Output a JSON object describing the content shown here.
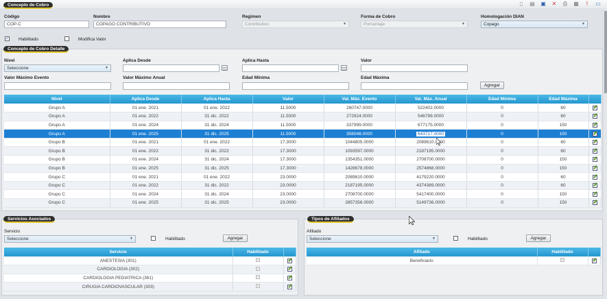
{
  "toolbar": {
    "icons": [
      "page-icon",
      "document-icon",
      "save-icon",
      "delete-icon",
      "print-icon",
      "export-icon",
      "alert-icon",
      "help-icon"
    ]
  },
  "concepto": {
    "title": "Concepto de Cobro",
    "codigo_label": "Código",
    "codigo_value": "COP-C",
    "nombre_label": "Nombre",
    "nombre_value": "COPAGO CONTRIBUTIVO",
    "regimen_label": "Regimen",
    "regimen_value": "Contributivo",
    "forma_label": "Forma de Cobro",
    "forma_value": "Porcentaje",
    "homologacion_label": "Homologación DIAN",
    "homologacion_value": "Copago",
    "habilitado_label": "Habilitado",
    "modifica_label": "Modifica Valor"
  },
  "detalle": {
    "title": "Concepto de Cobro Detalle",
    "nivel_label": "Nivel",
    "nivel_value": "Seleccione",
    "aplica_desde_label": "Aplica Desde",
    "aplica_hasta_label": "Aplica Hasta",
    "valor_label": "Valor",
    "valor_max_evento_label": "Valor Máximo Evento",
    "valor_max_anual_label": "Valor Máximo Anual",
    "edad_min_label": "Edad Mínima",
    "edad_max_label": "Edad Máxima",
    "agregar_label": "Agregar"
  },
  "grid": {
    "headers": [
      "Nivel",
      "Aplica Desde",
      "Aplica Hasta",
      "Valor",
      "Val. Máx. Evento",
      "Val. Máx. Anual",
      "Edad Mínima",
      "Edad Máxima"
    ],
    "rows": [
      [
        "Grupo A",
        "01 ene. 2021",
        "01 ene. 2022",
        "11.5000",
        "260747.0000",
        "522402.0000",
        "0",
        "60"
      ],
      [
        "Grupo A",
        "01 ene. 2022",
        "31 dic. 2022",
        "11.5000",
        "272924.0000",
        "546799.0000",
        "0",
        "60"
      ],
      [
        "Grupo A",
        "01 ene. 2024",
        "31 dic. 2024",
        "11.5000",
        "337999.0000",
        "677175.0000",
        "0",
        "150"
      ],
      [
        "Grupo A",
        "01 ene. 2025",
        "31 dic. 2025",
        "11.5000",
        "356048.0000",
        "643717.0000",
        "0",
        "150"
      ],
      [
        "Grupo B",
        "01 ene. 2021",
        "01 ene. 2022",
        "17.3000",
        "1044805.0000",
        "2089610.0000",
        "0",
        "60"
      ],
      [
        "Grupo B",
        "01 ene. 2022",
        "31 dic. 2022",
        "17.3000",
        "1093597.0000",
        "2187195.0000",
        "0",
        "60"
      ],
      [
        "Grupo B",
        "01 ene. 2024",
        "31 dic. 2024",
        "17.3000",
        "1354351.0000",
        "2708700.0000",
        "0",
        "150"
      ],
      [
        "Grupo B",
        "01 ene. 2025",
        "31 dic. 2025",
        "17.3000",
        "1428678.0000",
        "2574868.0000",
        "0",
        "150"
      ],
      [
        "Grupo C",
        "01 ene. 2021",
        "01 ene. 2022",
        "23.0000",
        "2089610.0000",
        "4179220.0000",
        "0",
        "60"
      ],
      [
        "Grupo C",
        "01 ene. 2022",
        "31 dic. 2022",
        "23.0000",
        "2187195.0000",
        "4374389.0000",
        "0",
        "60"
      ],
      [
        "Grupo C",
        "01 ene. 2024",
        "31 dic. 2024",
        "23.0000",
        "2708700.0000",
        "5417400.0000",
        "0",
        "150"
      ],
      [
        "Grupo C",
        "01 ene. 2025",
        "31 dic. 2025",
        "23.0000",
        "2857356.0000",
        "5149736.0000",
        "0",
        "150"
      ]
    ],
    "selected_row": 3
  },
  "servicios": {
    "title": "Servicios Asociados",
    "servicio_label": "Servicio",
    "servicio_value": "Seleccione",
    "habilitado_label": "Habilitado",
    "agregar_label": "Agregar",
    "headers": [
      "Servicio",
      "Habilitado"
    ],
    "rows": [
      "ANESTESIA (301)",
      "CARDIOLOGIA (302)",
      "CARDIOLOGIA PEDIATRICA (361)",
      "CIRUGIA CARDIOVASCULAR (303)"
    ]
  },
  "afiliados": {
    "title": "Tipos de Afiliados",
    "afiliado_label": "Afiliado",
    "afiliado_value": "Seleccione",
    "habilitado_label": "Habilitado",
    "agregar_label": "Agregar",
    "headers": [
      "Afiliado",
      "Habilitado"
    ],
    "rows": [
      "Beneficiario"
    ]
  }
}
